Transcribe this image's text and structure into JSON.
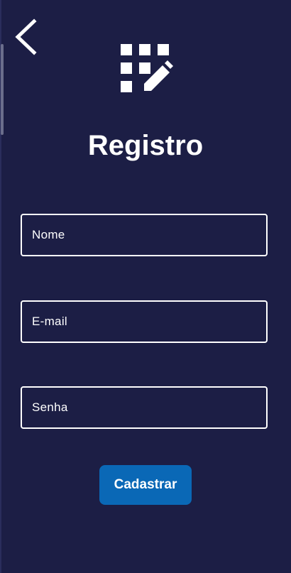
{
  "header": {
    "back_icon": "chevron-left-icon",
    "logo_icon": "grid-pencil-icon"
  },
  "page": {
    "title": "Registro"
  },
  "form": {
    "name_placeholder": "Nome",
    "email_placeholder": "E-mail",
    "password_placeholder": "Senha",
    "submit_label": "Cadastrar"
  },
  "colors": {
    "background": "#1c1e45",
    "accent": "#0a68b6",
    "text": "#ffffff"
  }
}
